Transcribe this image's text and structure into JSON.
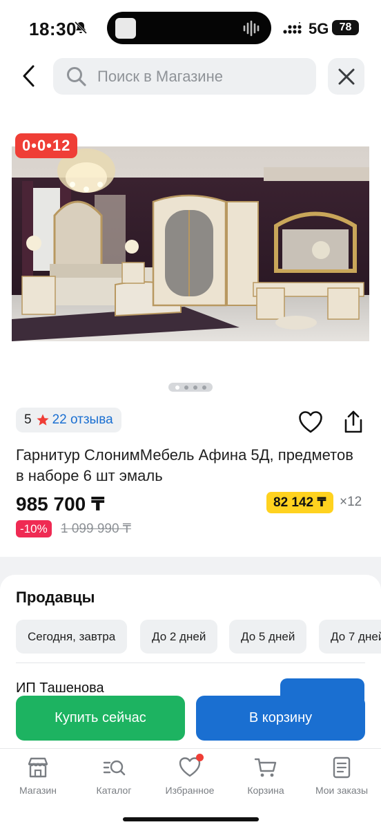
{
  "status_bar": {
    "time": "18:30",
    "network": "5G",
    "battery": "78",
    "icons": [
      "bell-off-icon",
      "cellular-signal-icon",
      "battery-icon",
      "audio-wave-icon"
    ]
  },
  "header": {
    "search_placeholder": "Поиск в Магазине",
    "icons": [
      "back-chevron-icon",
      "search-icon",
      "close-icon"
    ]
  },
  "product": {
    "timer": "0•0•12",
    "gallery_pages": 4,
    "gallery_active_page": 1,
    "rating": "5",
    "reviews": "22 отзыва",
    "title": "Гарнитур СлонимМебель Афина 5Д, предметов в наборе 6 шт эмаль",
    "price": "985 700 ₸",
    "installment_amount": "82 142 ₸",
    "installment_months": "×12",
    "discount": "-10%",
    "old_price": "1 099 990 ₸"
  },
  "sellers": {
    "title": "Продавцы",
    "delivery_filters": [
      "Сегодня, завтра",
      "До 2 дней",
      "До 5 дней",
      "До 7 дней"
    ],
    "first_seller_name": "ИП Ташенова"
  },
  "actions": {
    "buy_now": "Купить сейчас",
    "add_to_cart": "В корзину"
  },
  "tab_bar": {
    "items": [
      {
        "label": "Магазин",
        "icon": "shop-icon"
      },
      {
        "label": "Каталог",
        "icon": "catalog-search-icon"
      },
      {
        "label": "Избранное",
        "icon": "heart-icon"
      },
      {
        "label": "Корзина",
        "icon": "cart-icon"
      },
      {
        "label": "Мои заказы",
        "icon": "orders-icon"
      }
    ]
  },
  "colors": {
    "accent_blue": "#1a6fd1",
    "buy_green": "#1db361",
    "timer_red": "#ef3e36",
    "discount_pink": "#ef2a53",
    "installment_yellow": "#ffd21f"
  }
}
